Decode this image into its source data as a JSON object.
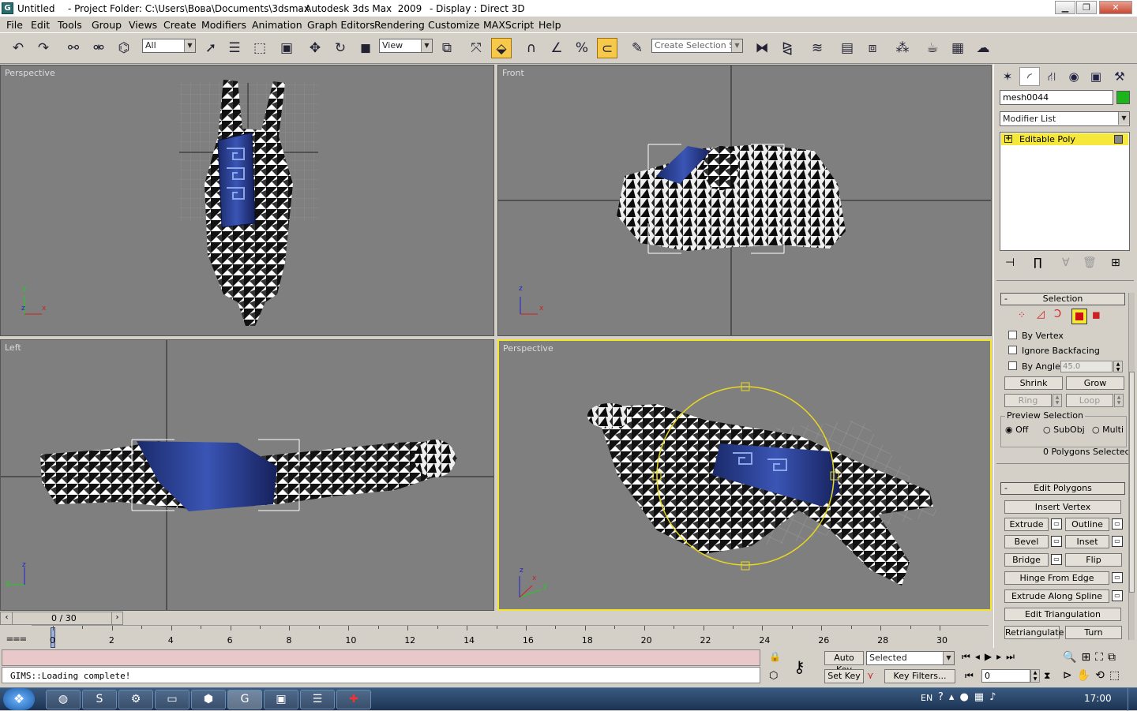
{
  "window": {
    "title_file": "Untitled",
    "title_project": "- Project Folder: C:\\Users\\Вова\\Documents\\3dsmax",
    "title_app": "- Autodesk 3ds Max  2009",
    "title_display": "- Display : Direct 3D",
    "minimize": "▁",
    "maximize": "❐",
    "close": "✕"
  },
  "menu": [
    "File",
    "Edit",
    "Tools",
    "Group",
    "Views",
    "Create",
    "Modifiers",
    "Animation",
    "Graph Editors",
    "Rendering",
    "Customize",
    "MAXScript",
    "Help"
  ],
  "toolbar": {
    "selection_filter": "All",
    "ref_coord": "View",
    "named_selection_placeholder": "Create Selection Se"
  },
  "viewports": {
    "top_left": {
      "label": "Perspective",
      "axis_y": "y",
      "axis_x": "x",
      "axis_z": "z"
    },
    "top_right": {
      "label": "Front",
      "axis_z": "z",
      "axis_x": "x"
    },
    "bottom_left": {
      "label": "Left",
      "axis_z": "z",
      "axis_y": "y"
    },
    "bottom_right": {
      "label": "Perspective",
      "axis_z": "z",
      "axis_y": "y",
      "axis_x": "x"
    }
  },
  "command_panel": {
    "object_name": "mesh0044",
    "object_color": "#1eb41e",
    "modifier_list": "Modifier List",
    "stack_item": "Editable Poly",
    "stack_plus": "+",
    "selection": {
      "title": "Selection",
      "by_vertex": "By Vertex",
      "ignore_backfacing": "Ignore Backfacing",
      "by_angle": "By Angle:",
      "angle_value": "45.0",
      "shrink": "Shrink",
      "grow": "Grow",
      "ring": "Ring",
      "loop": "Loop",
      "preview_selection": "Preview Selection",
      "off": "Off",
      "subobj": "SubObj",
      "multi": "Multi",
      "status": "0 Polygons Selected"
    },
    "edit_polygons": {
      "title": "Edit Polygons",
      "insert_vertex": "Insert Vertex",
      "extrude": "Extrude",
      "outline": "Outline",
      "bevel": "Bevel",
      "inset": "Inset",
      "bridge": "Bridge",
      "flip": "Flip",
      "hinge_from_edge": "Hinge From Edge",
      "extrude_along_spline": "Extrude Along Spline",
      "edit_triangulation": "Edit Triangulation",
      "retriangulate": "Retriangulate",
      "turn": "Turn"
    },
    "rollout_minus": "-"
  },
  "timeline": {
    "slider_text": "0 / 30",
    "current_frame": 0,
    "total_frames": 30,
    "ticks": [
      "0",
      "2",
      "4",
      "6",
      "8",
      "10",
      "12",
      "14",
      "16",
      "18",
      "20",
      "22",
      "24",
      "26",
      "28",
      "30"
    ]
  },
  "status": {
    "listener_text": "GIMS::Loading complete!",
    "auto_key": "Auto Key",
    "set_key": "Set Key",
    "key_mode": "Selected",
    "key_filters": "Key Filters...",
    "frame_field": "0"
  },
  "taskbar": {
    "language": "EN",
    "clock": "17:00"
  }
}
